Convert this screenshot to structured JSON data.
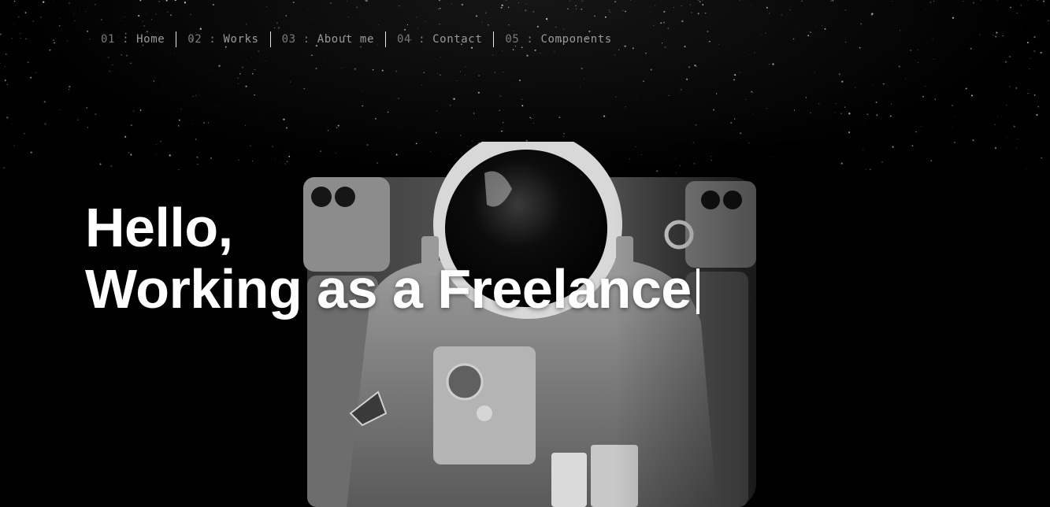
{
  "nav": {
    "items": [
      {
        "num": "01",
        "sep": " : ",
        "label": "Home"
      },
      {
        "num": "02",
        "sep": " : ",
        "label": "Works"
      },
      {
        "num": "03",
        "sep": " : ",
        "label": "About me"
      },
      {
        "num": "04",
        "sep": " : ",
        "label": "Contact"
      },
      {
        "num": "05",
        "sep": " : ",
        "label": "Components"
      }
    ]
  },
  "hero": {
    "line1": "Hello,",
    "line2": "Working as a Freelance"
  },
  "colors": {
    "background": "#000000",
    "headline": "#ffffff",
    "nav_text": "#9a9a9a",
    "nav_divider": "#e6e6e6"
  }
}
